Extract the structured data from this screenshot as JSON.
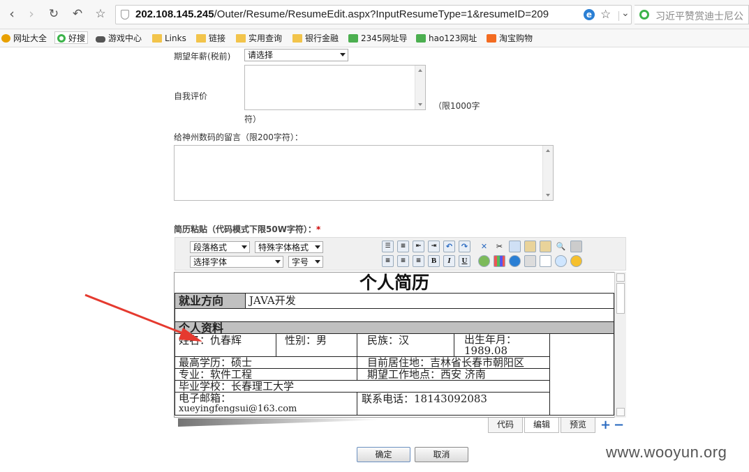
{
  "browser": {
    "url_host": "202.108.145.245",
    "url_path": "/Outer/Resume/ResumeEdit.aspx?InputResumeType=1&resumeID=209",
    "search_text": "习近平赞赏迪士尼公",
    "bookmarks": [
      "网址大全",
      "好搜",
      "游戏中心",
      "Links",
      "链接",
      "实用查询",
      "银行金融",
      "2345网址导",
      "hao123网址",
      "淘宝购物"
    ]
  },
  "form": {
    "salary_label": "期望年薪(税前)",
    "salary_value": "请选择",
    "self_eval_label": "自我评价",
    "self_eval_limit": "（限1000字",
    "self_eval_limit2": "符）",
    "message_label": "给神州数码的留言（限200字符）：",
    "paste_label": "简历粘贴（代码模式下限50W字符）：",
    "required_mark": "*"
  },
  "editor": {
    "paragraph_format": "段落格式",
    "special_font": "特殊字体格式",
    "font_select": "选择字体",
    "font_size": "字号",
    "bold": "B",
    "italic": "I",
    "underline": "U",
    "tabs": [
      "代码",
      "编辑",
      "预览"
    ],
    "plus": "+",
    "minus": "−"
  },
  "resume": {
    "title": "个人简历",
    "direction_label": "就业方向",
    "direction_value": "JAVA开发",
    "section": "个人资料",
    "name": "姓名：仇春辉",
    "gender": "性别：男",
    "ethnicity": "民族：汉",
    "birth_label": "出生年月：",
    "birth_value": "1989.08",
    "education": "最高学历：硕士",
    "residence": "目前居住地：吉林省长春市朝阳区",
    "major": "专业：软件工程",
    "work_location": "期望工作地点：西安 济南",
    "school": "毕业学校：长春理工大学",
    "email_label": "电子邮箱：",
    "email_value": "xueyingfengsui@163.com",
    "phone": "联系电话：18143092083"
  },
  "buttons": {
    "confirm": "确定",
    "cancel": "取消"
  },
  "watermark": "www.wooyun.org",
  "colors": {
    "arrow": "#e53a2f",
    "required": "#cc0000"
  }
}
